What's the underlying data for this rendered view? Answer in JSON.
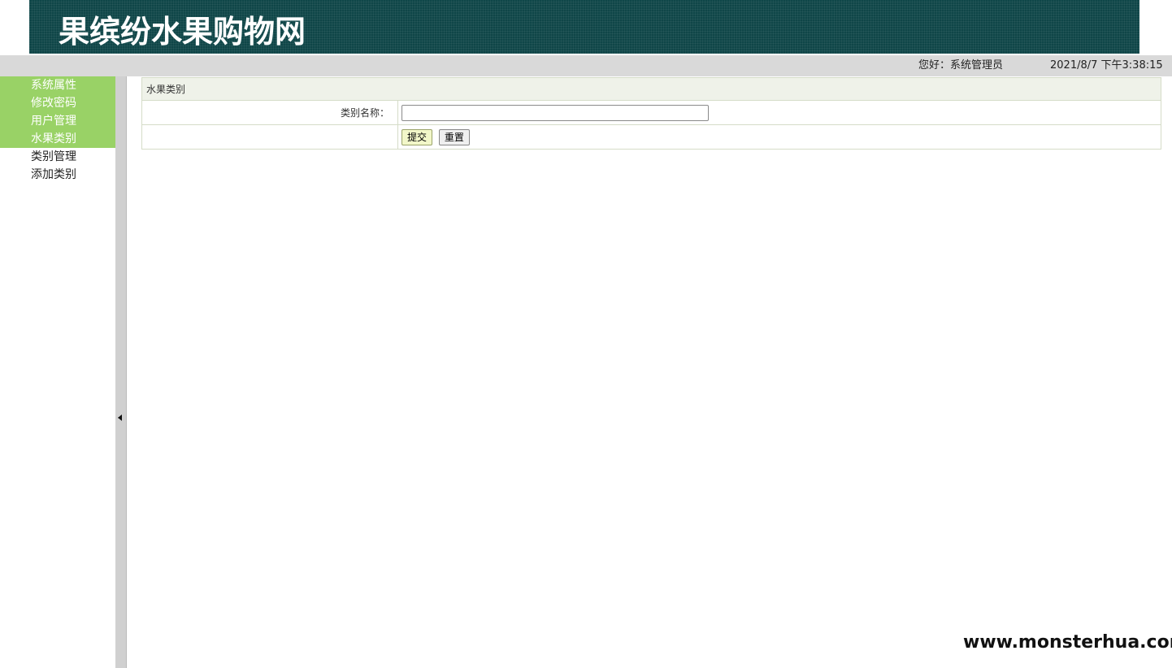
{
  "header": {
    "site_title": "果缤纷水果购物网"
  },
  "topbar": {
    "greeting": "您好：系统管理员",
    "datetime": "2021/8/7 下午3:38:15"
  },
  "sidebar": {
    "items": [
      {
        "label": "系统属性",
        "type": "main"
      },
      {
        "label": "修改密码",
        "type": "main"
      },
      {
        "label": "用户管理",
        "type": "main"
      },
      {
        "label": "水果类别",
        "type": "main"
      },
      {
        "label": "类别管理",
        "type": "sub"
      },
      {
        "label": "添加类别",
        "type": "sub"
      }
    ]
  },
  "form": {
    "title": "水果类别",
    "field_label": "类别名称：",
    "field_value": "",
    "submit_label": "提交",
    "reset_label": "重置"
  },
  "watermark": "www.monsterhua.com",
  "colors": {
    "header_bg": "#0f4648",
    "menu_active_bg": "#99d266",
    "topbar_bg": "#d9d9d9",
    "form_header_bg": "#eff2e9"
  }
}
